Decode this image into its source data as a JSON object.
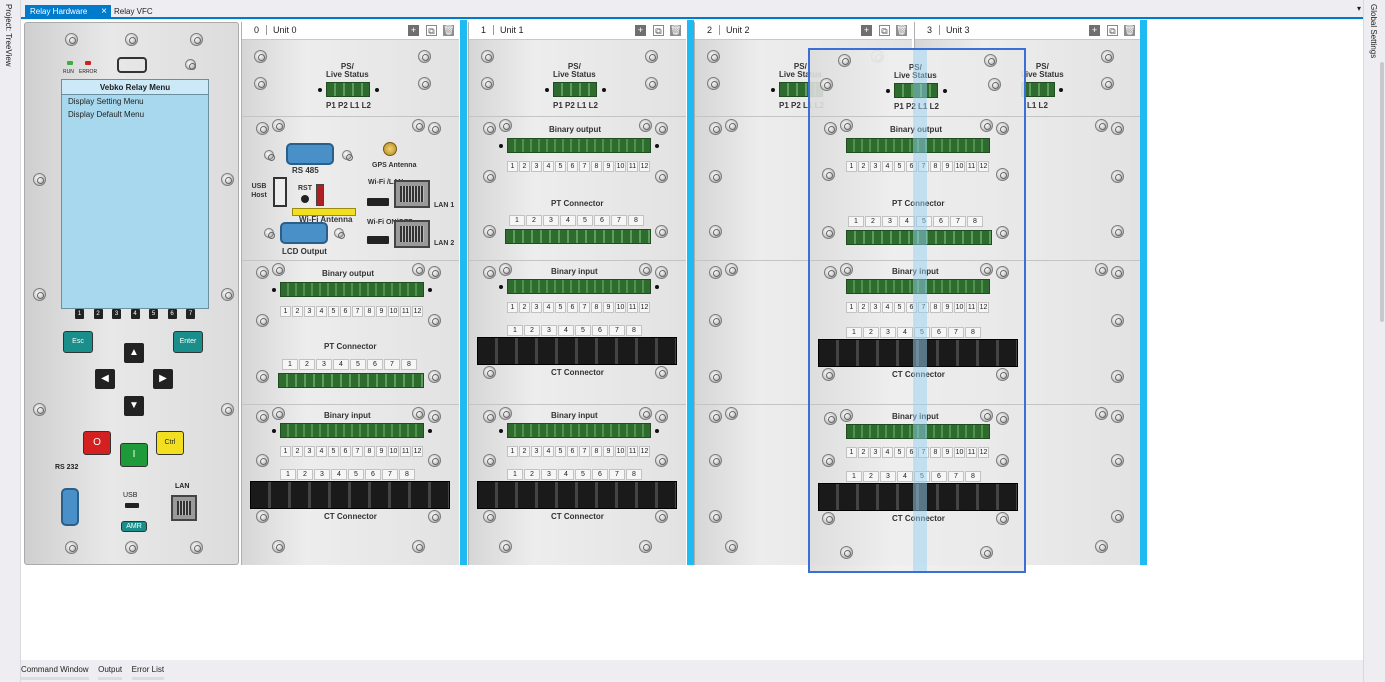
{
  "sidebar_left": {
    "label": "Project: TreeView"
  },
  "sidebar_right": {
    "label": "Global Settings"
  },
  "tabs": {
    "active": "Relay Hardware",
    "close": "×",
    "inactive": "Relay VFC",
    "dropdown": "▾"
  },
  "front_panel": {
    "led_run": "RUN",
    "led_error": "ERROR",
    "menu_title": "Vebko Relay Menu",
    "menu_items": [
      "Display Setting Menu",
      "Display Default Menu"
    ],
    "fkeys": [
      "1",
      "2",
      "3",
      "4",
      "5",
      "6",
      "7"
    ],
    "esc": "Esc",
    "enter": "Enter",
    "stop": "O",
    "start": "I",
    "ctrl": "Ctrl",
    "rs232": "RS 232",
    "usb": "USB",
    "lan": "LAN",
    "amr": "AMR"
  },
  "units": [
    {
      "index": "0",
      "name": "Unit 0"
    },
    {
      "index": "1",
      "name": "Unit 1"
    },
    {
      "index": "2",
      "name": "Unit 2"
    },
    {
      "index": "3",
      "name": "Unit 3"
    }
  ],
  "header_icons": {
    "add": "+",
    "copy": "⧉",
    "delete": "🗑"
  },
  "labels": {
    "ps_line1": "PS/",
    "ps_line2": "Live Status",
    "ps_pins": "P1 P2  L1 L2",
    "binary_output": "Binary output",
    "binary_input": "Binary input",
    "pt_connector": "PT Connector",
    "ct_connector": "CT Connector",
    "rs485": "RS 485",
    "gps": "GPS Antenna",
    "usb_host": "USB Host",
    "rst": "RST",
    "wifi_lan": "Wi-Fi /LAN",
    "lan1": "LAN 1",
    "wifi_antenna": "Wi-Fi Antenna",
    "wifi_onoff": "Wi-Fi ON/OFF",
    "lan2": "LAN 2",
    "lcd_output": "LCD Output"
  },
  "nums12": [
    "1",
    "2",
    "3",
    "4",
    "5",
    "6",
    "7",
    "8",
    "9",
    "10",
    "11",
    "12"
  ],
  "nums8": [
    "1",
    "2",
    "3",
    "4",
    "5",
    "6",
    "7",
    "8"
  ],
  "bottom_tabs": [
    "Command Window",
    "Output",
    "Error List"
  ]
}
